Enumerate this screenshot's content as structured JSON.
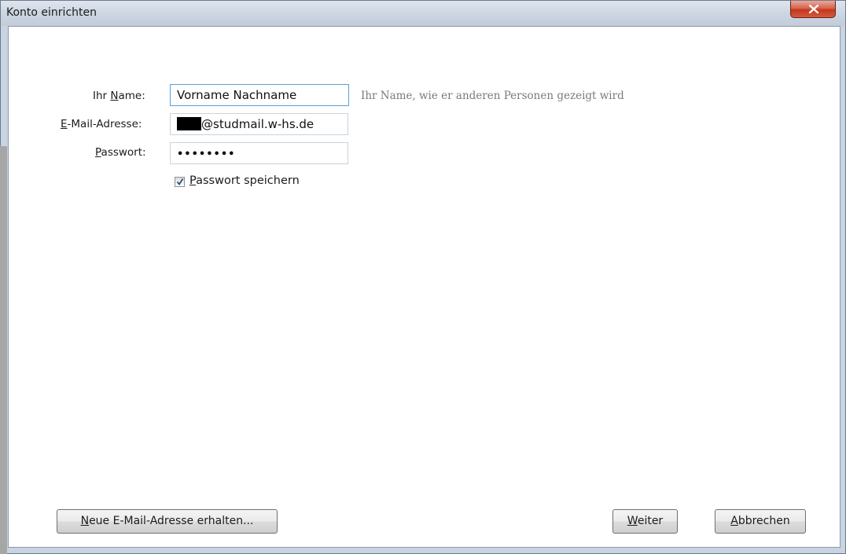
{
  "window": {
    "title": "Konto einrichten"
  },
  "form": {
    "name_label_pre": "Ihr ",
    "name_label_accel": "N",
    "name_label_post": "ame:",
    "name_value": "Vorname Nachname",
    "name_hint": "Ihr Name, wie er anderen Personen gezeigt wird",
    "email_label_accel": "E",
    "email_label_post": "-Mail-Adresse:",
    "email_value_suffix": "@studmail.w-hs.de",
    "password_label_accel": "P",
    "password_label_post": "asswort:",
    "password_value": "••••••••",
    "remember_accel": "P",
    "remember_label_post": "asswort speichern",
    "remember_checked": true
  },
  "buttons": {
    "new_address_accel": "N",
    "new_address_post": "eue E-Mail-Adresse erhalten...",
    "next_accel": "W",
    "next_post": "eiter",
    "cancel_accel": "A",
    "cancel_post": "bbrechen"
  },
  "colors": {
    "focus_border": "#5a9fd6",
    "close_button": "#c2381d",
    "hint_text": "#7a7a7a"
  },
  "icons": {
    "close": "close-icon",
    "checkmark": "checkmark-icon"
  }
}
